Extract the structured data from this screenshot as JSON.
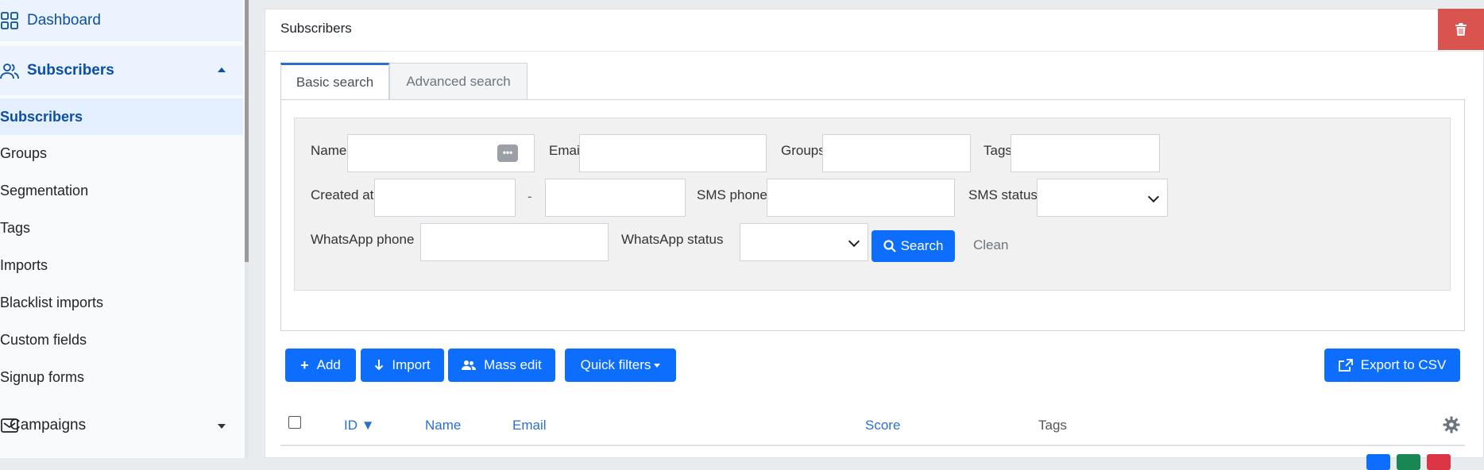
{
  "sidebar": {
    "dashboard_label": "Dashboard",
    "subscribers_section_label": "Subscribers",
    "items": [
      {
        "label": "Subscribers",
        "active": true
      },
      {
        "label": "Groups"
      },
      {
        "label": "Segmentation"
      },
      {
        "label": "Tags"
      },
      {
        "label": "Imports"
      },
      {
        "label": "Blacklist imports"
      },
      {
        "label": "Custom fields"
      },
      {
        "label": "Signup forms"
      }
    ],
    "campaigns_label": "Campaigns"
  },
  "card": {
    "title": "Subscribers",
    "delete_icon": "trash-icon"
  },
  "tabs": [
    {
      "label": "Basic search",
      "active": true
    },
    {
      "label": "Advanced search"
    }
  ],
  "search": {
    "name_label": "Name",
    "email_label": "Email",
    "groups_label": "Groups",
    "tags_label": "Tags",
    "created_at_label": "Created at",
    "date_separator": "-",
    "sms_phone_label": "SMS phone",
    "sms_status_label": "SMS status",
    "whatsapp_phone_label": "WhatsApp phone",
    "whatsapp_status_label": "WhatsApp status",
    "search_button": "Search",
    "clean_button": "Clean",
    "name_badge": "•••"
  },
  "toolbar": {
    "add": "Add",
    "import": "Import",
    "mass_edit": "Mass edit",
    "quick_filters": "Quick filters",
    "export_csv": "Export to CSV"
  },
  "table": {
    "columns": [
      "ID ▼",
      "Name",
      "Email",
      "Score",
      "Tags"
    ]
  },
  "colors": {
    "primary": "#0d6efd",
    "danger": "#d9534f",
    "link": "#2a6fd0",
    "sidebar_active": "#0d4fa3"
  }
}
